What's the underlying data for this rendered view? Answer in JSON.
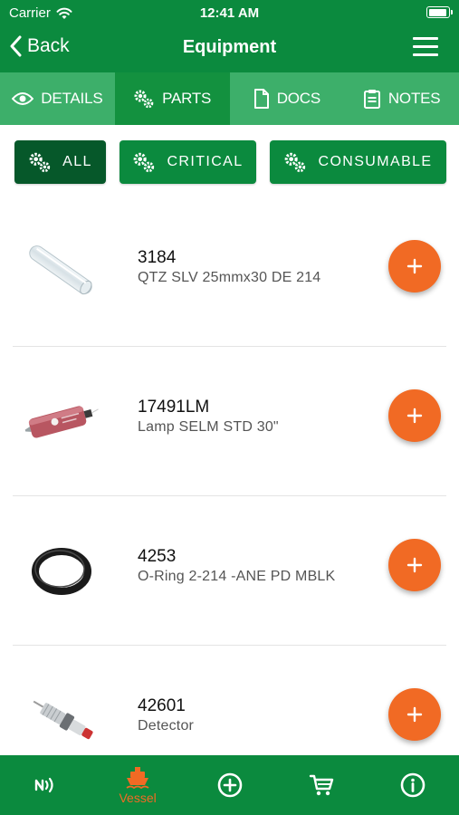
{
  "status_bar": {
    "carrier": "Carrier",
    "time": "12:41 AM"
  },
  "nav": {
    "back_label": "Back",
    "title": "Equipment"
  },
  "tabs": [
    {
      "label": "DETAILS",
      "icon": "eye-icon",
      "active": false
    },
    {
      "label": "PARTS",
      "icon": "gears-icon",
      "active": true
    },
    {
      "label": "DOCS",
      "icon": "document-icon",
      "active": false
    },
    {
      "label": "NOTES",
      "icon": "clipboard-icon",
      "active": false
    }
  ],
  "filters": [
    {
      "label": "ALL",
      "selected": true
    },
    {
      "label": "CRITICAL",
      "selected": false
    },
    {
      "label": "CONSUMABLE",
      "selected": false
    }
  ],
  "parts": [
    {
      "part_number": "3184",
      "description": "QTZ SLV 25mmx30  DE 214",
      "image": "quartz-sleeve-image"
    },
    {
      "part_number": "17491LM",
      "description": "Lamp SELM STD 30\"",
      "image": "uv-lamp-image"
    },
    {
      "part_number": "4253",
      "description": "O-Ring 2-214 -ANE PD MBLK",
      "image": "o-ring-image"
    },
    {
      "part_number": "42601",
      "description": "Detector",
      "image": "detector-image"
    }
  ],
  "bottom_nav": [
    {
      "icon": "nfc-icon",
      "label": ""
    },
    {
      "icon": "ship-icon",
      "label": "Vessel",
      "active": true
    },
    {
      "icon": "add-circle-icon",
      "label": ""
    },
    {
      "icon": "cart-icon",
      "label": ""
    },
    {
      "icon": "info-icon",
      "label": ""
    }
  ],
  "colors": {
    "primary_green": "#0b8a3e",
    "tab_green": "#3daf6a",
    "selected_chip": "#06582a",
    "accent_orange": "#f16a24"
  }
}
